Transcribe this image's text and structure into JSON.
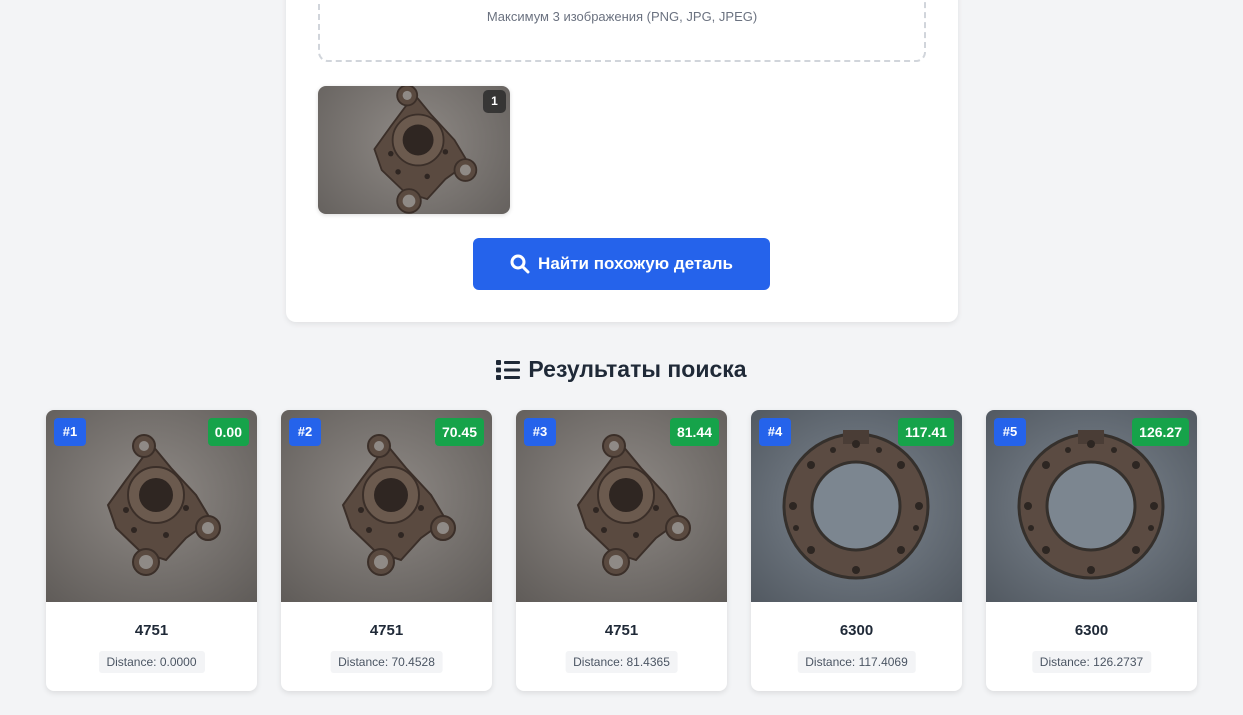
{
  "upload": {
    "hint": "Максимум 3 изображения (PNG, JPG, JPEG)",
    "previews": [
      {
        "index": "1",
        "icon": "flange-photo"
      }
    ],
    "search_button_label": "Найти похожую деталь",
    "search_button_icon": "search-icon"
  },
  "results": {
    "title": "Результаты поиска",
    "title_icon": "list-icon",
    "items": [
      {
        "rank": "#1",
        "score": "0.00",
        "part": "4751",
        "distance": "Distance: 0.0000",
        "image": "flange-photo"
      },
      {
        "rank": "#2",
        "score": "70.45",
        "part": "4751",
        "distance": "Distance: 70.4528",
        "image": "flange-photo"
      },
      {
        "rank": "#3",
        "score": "81.44",
        "part": "4751",
        "distance": "Distance: 81.4365",
        "image": "flange-photo"
      },
      {
        "rank": "#4",
        "score": "117.41",
        "part": "6300",
        "distance": "Distance: 117.4069",
        "image": "ring-plate-photo"
      },
      {
        "rank": "#5",
        "score": "126.27",
        "part": "6300",
        "distance": "Distance: 126.2737",
        "image": "ring-plate-photo"
      }
    ]
  },
  "colors": {
    "accent": "#2563eb",
    "score_badge": "#16a34a",
    "background": "#f3f4f6"
  }
}
